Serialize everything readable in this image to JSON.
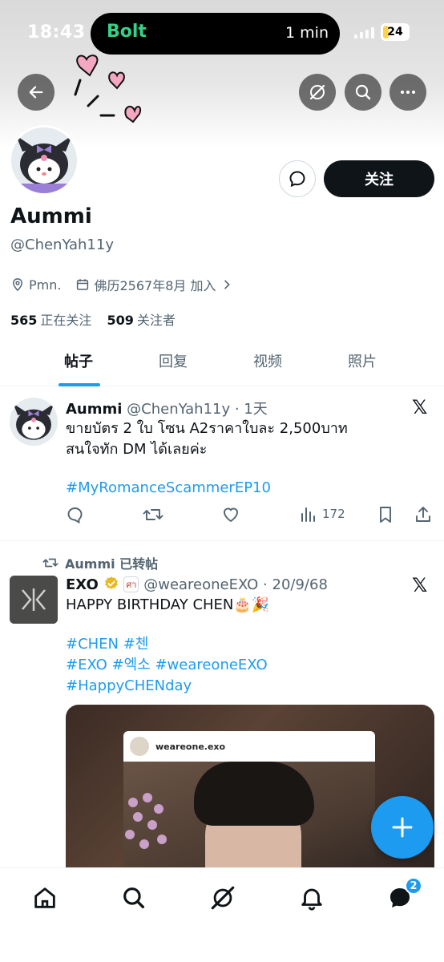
{
  "status_bar": {
    "time": "18:43",
    "app_name": "Bolt",
    "eta": "1 min",
    "battery": "24",
    "battery_level": 0.24
  },
  "profile": {
    "display_name": "Aummi",
    "handle": "@ChenYah11y",
    "location": "Pmn.",
    "joined": "佛历2567年8月 加入",
    "following_count": "565",
    "following_label": "正在关注",
    "followers_count": "509",
    "followers_label": "关注者",
    "follow_label": "关注"
  },
  "tabs": [
    {
      "label": "帖子",
      "active": true
    },
    {
      "label": "回复",
      "active": false
    },
    {
      "label": "视频",
      "active": false
    },
    {
      "label": "照片",
      "active": false
    }
  ],
  "tweets": [
    {
      "name": "Aummi",
      "meta": "@ChenYah11y · 1天",
      "lines": [
        "ขายบัตร 2 ใบ โซน A2ราคาใบละ  2,500บาท",
        "สนใจทัก DM ได้เลยค่ะ"
      ],
      "hashtags": [
        "#MyRomanceScammerEP10"
      ],
      "views": "172"
    },
    {
      "retweet_label": "Aummi 已转帖",
      "name": "EXO",
      "badge_text": "ศา",
      "meta": "@weareoneEXO · 20/9/68",
      "lines": [
        "HAPPY BIRTHDAY CHEN🎂🎉"
      ],
      "hashtag_lines": [
        "#CHEN #첸",
        "#EXO #엑소 #weareoneEXO",
        "#HappyCHENday"
      ],
      "media_account": "weareone.exo"
    }
  ],
  "nav": {
    "messages_badge": "2"
  },
  "colors": {
    "accent": "#1d9bf0",
    "text": "#0f1419",
    "muted": "#536471"
  },
  "icons": [
    "back-arrow-icon",
    "slash-circle-icon",
    "search-icon",
    "more-icon",
    "message-icon",
    "location-icon",
    "calendar-icon",
    "chevron-right-icon",
    "x-logo-icon",
    "reply-icon",
    "retweet-icon",
    "like-icon",
    "views-icon",
    "bookmark-icon",
    "share-icon",
    "verified-icon",
    "plus-icon",
    "home-icon",
    "grok-icon",
    "bell-icon",
    "messages-icon"
  ]
}
